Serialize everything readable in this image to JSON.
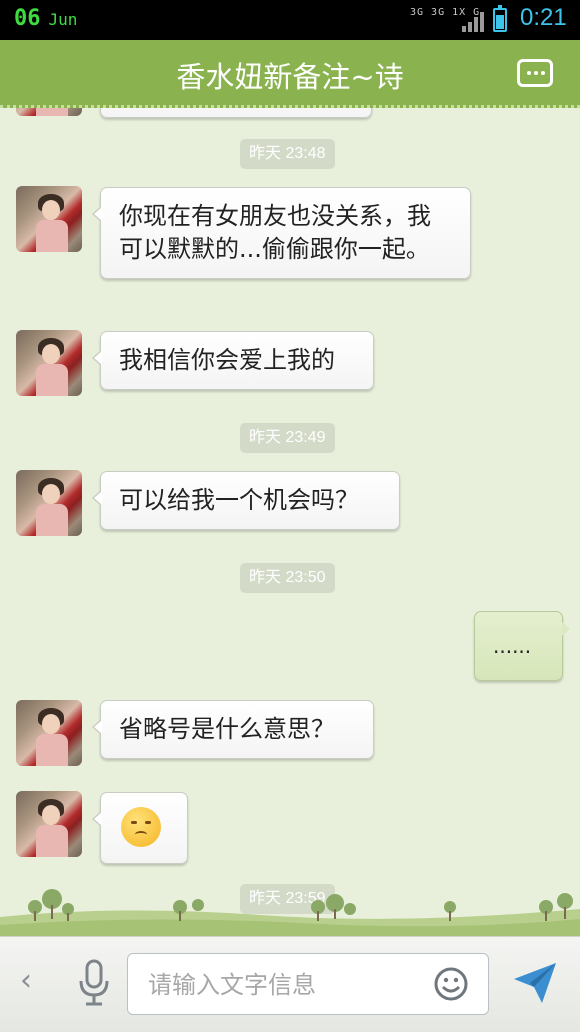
{
  "status_bar": {
    "date": "06",
    "month": "Jun",
    "network": "3G 3G 1X G",
    "time": "0:21"
  },
  "header": {
    "title": "香水妞新备注~诗",
    "menu_icon": "more-menu-icon"
  },
  "messages": [
    {
      "type": "time",
      "text": "昨天 23:48"
    },
    {
      "type": "in",
      "text": "你现在有女朋友也没关系，我可以默默的...偷偷跟你一起。"
    },
    {
      "type": "in",
      "text": "我相信你会爱上我的"
    },
    {
      "type": "time",
      "text": "昨天 23:49"
    },
    {
      "type": "in",
      "text": "可以给我一个机会吗？"
    },
    {
      "type": "time",
      "text": "昨天 23:50"
    },
    {
      "type": "out",
      "text": "......"
    },
    {
      "type": "in",
      "text": "省略号是什么意思？"
    },
    {
      "type": "in",
      "emoji": "shy-emoji-icon"
    },
    {
      "type": "time",
      "text": "昨天 23:59"
    }
  ],
  "input": {
    "placeholder": "请输入文字信息"
  },
  "colors": {
    "header": "#8ab34f",
    "background": "#e8f0dc",
    "accent": "#3cc4ea"
  }
}
